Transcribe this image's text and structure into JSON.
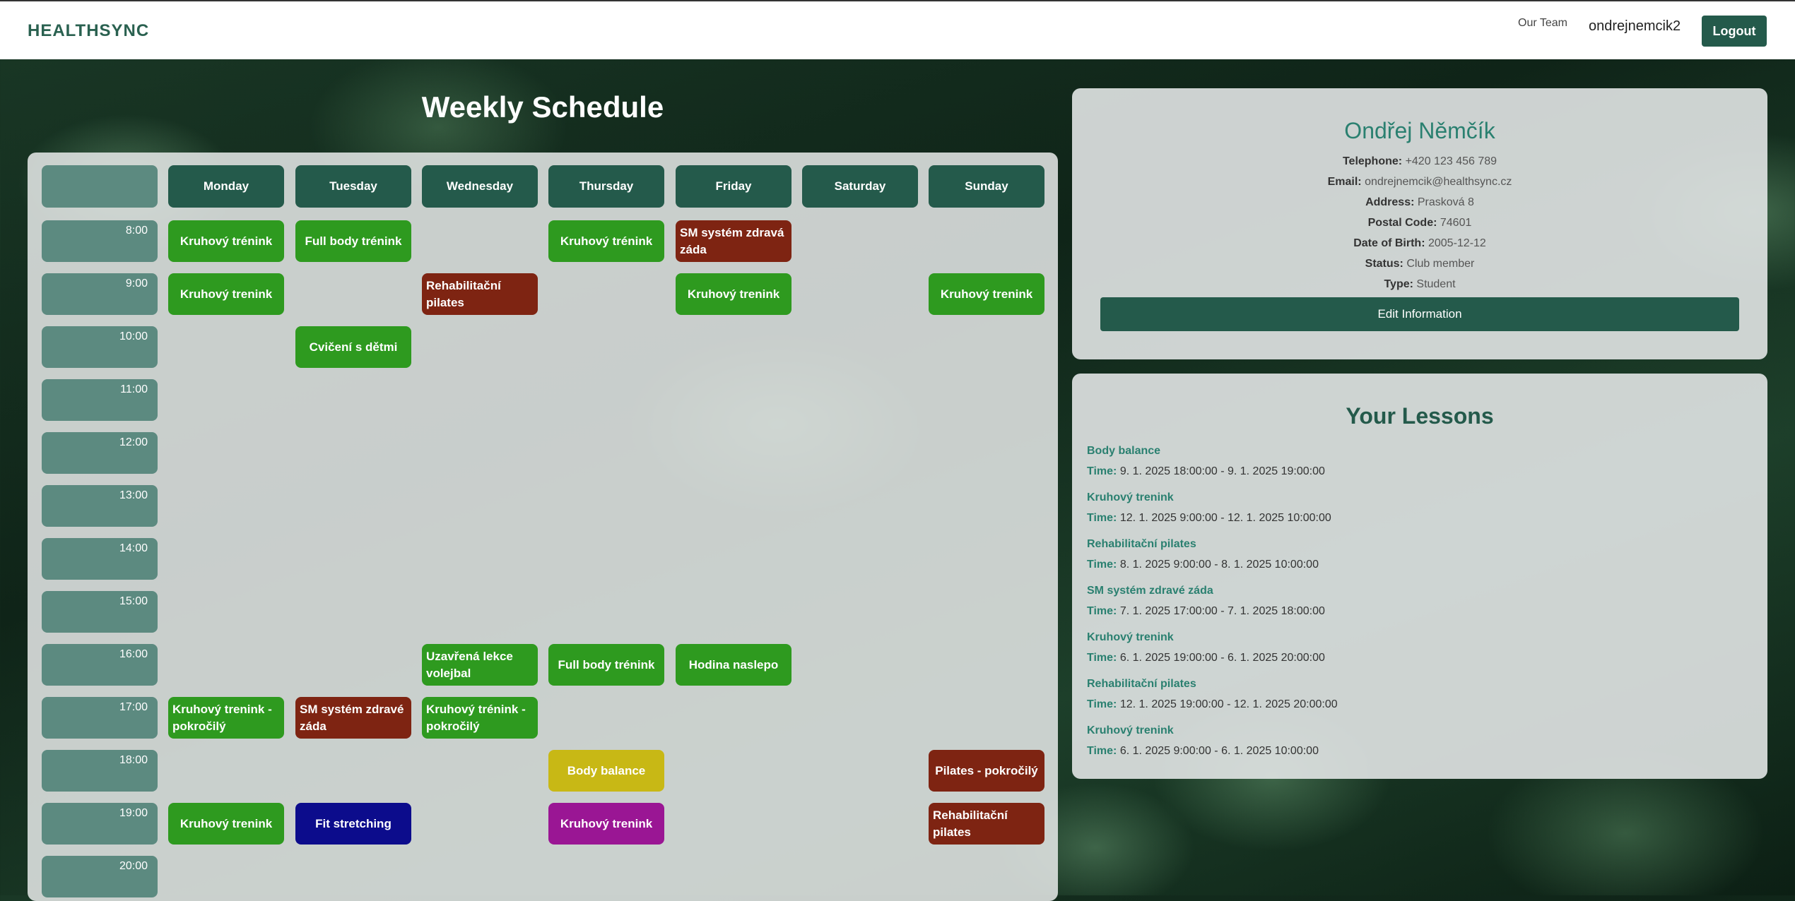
{
  "header": {
    "brand": "HEALTHSYNC",
    "nav_team": "Our Team",
    "username": "ondrejnemcik2",
    "logout_label": "Logout"
  },
  "schedule": {
    "title": "Weekly Schedule",
    "days": [
      "Monday",
      "Tuesday",
      "Wednesday",
      "Thursday",
      "Friday",
      "Saturday",
      "Sunday"
    ],
    "times": [
      "8:00",
      "9:00",
      "10:00",
      "11:00",
      "12:00",
      "13:00",
      "14:00",
      "15:00",
      "16:00",
      "17:00",
      "18:00",
      "19:00",
      "20:00"
    ],
    "lessons": [
      {
        "day": 0,
        "time": 0,
        "label": "Kruhový trénink",
        "color": "#2e9a1f",
        "align": "center"
      },
      {
        "day": 1,
        "time": 0,
        "label": "Full body trénink",
        "color": "#2e9a1f",
        "align": "center"
      },
      {
        "day": 3,
        "time": 0,
        "label": "Kruhový trénink",
        "color": "#2e9a1f",
        "align": "center"
      },
      {
        "day": 4,
        "time": 0,
        "label": "SM systém zdravá záda",
        "color": "#7e2412",
        "align": "left"
      },
      {
        "day": 0,
        "time": 1,
        "label": "Kruhový trenink",
        "color": "#2e9a1f",
        "align": "center"
      },
      {
        "day": 2,
        "time": 1,
        "label": "Rehabilitační pilates",
        "color": "#7e2412",
        "align": "left"
      },
      {
        "day": 4,
        "time": 1,
        "label": "Kruhový trenink",
        "color": "#2e9a1f",
        "align": "center"
      },
      {
        "day": 6,
        "time": 1,
        "label": "Kruhový trenink",
        "color": "#2e9a1f",
        "align": "center"
      },
      {
        "day": 1,
        "time": 2,
        "label": "Cvičení s dětmi",
        "color": "#2e9a1f",
        "align": "center"
      },
      {
        "day": 2,
        "time": 8,
        "label": "Uzavřená lekce volejbal",
        "color": "#2e9a1f",
        "align": "left"
      },
      {
        "day": 3,
        "time": 8,
        "label": "Full body trénink",
        "color": "#2e9a1f",
        "align": "center"
      },
      {
        "day": 4,
        "time": 8,
        "label": "Hodina naslepo",
        "color": "#2e9a1f",
        "align": "center"
      },
      {
        "day": 0,
        "time": 9,
        "label": "Kruhový trenink - pokročilý",
        "color": "#2e9a1f",
        "align": "left"
      },
      {
        "day": 1,
        "time": 9,
        "label": "SM systém zdravé záda",
        "color": "#7e2412",
        "align": "left"
      },
      {
        "day": 2,
        "time": 9,
        "label": "Kruhový trénink - pokročilý",
        "color": "#2e9a1f",
        "align": "left"
      },
      {
        "day": 3,
        "time": 10,
        "label": "Body balance",
        "color": "#c8b815",
        "align": "center"
      },
      {
        "day": 6,
        "time": 10,
        "label": "Pilates - pokročilý",
        "color": "#7e2412",
        "align": "center"
      },
      {
        "day": 0,
        "time": 11,
        "label": "Kruhový trenink",
        "color": "#2e9a1f",
        "align": "center"
      },
      {
        "day": 1,
        "time": 11,
        "label": "Fit stretching",
        "color": "#0c0c8c",
        "align": "center"
      },
      {
        "day": 3,
        "time": 11,
        "label": "Kruhový trenink",
        "color": "#9a1694",
        "align": "center"
      },
      {
        "day": 6,
        "time": 11,
        "label": "Rehabilitační pilates",
        "color": "#7e2412",
        "align": "left"
      }
    ]
  },
  "profile": {
    "name": "Ondřej Němčík",
    "fields": [
      {
        "label": "Telephone:",
        "value": "+420 123 456 789"
      },
      {
        "label": "Email:",
        "value": "ondrejnemcik@healthsync.cz"
      },
      {
        "label": "Address:",
        "value": "Prasková 8"
      },
      {
        "label": "Postal Code:",
        "value": "74601"
      },
      {
        "label": "Date of Birth:",
        "value": "2005-12-12"
      },
      {
        "label": "Status:",
        "value": "Club member"
      },
      {
        "label": "Type:",
        "value": "Student"
      }
    ],
    "edit_label": "Edit Information"
  },
  "your_lessons": {
    "title": "Your Lessons",
    "time_label": "Time:",
    "items": [
      {
        "name": "Body balance",
        "time": "9. 1. 2025 18:00:00 - 9. 1. 2025 19:00:00"
      },
      {
        "name": "Kruhový trenink",
        "time": "12. 1. 2025 9:00:00 - 12. 1. 2025 10:00:00"
      },
      {
        "name": "Rehabilitační pilates",
        "time": "8. 1. 2025 9:00:00 - 8. 1. 2025 10:00:00"
      },
      {
        "name": "SM systém zdravé záda",
        "time": "7. 1. 2025 17:00:00 - 7. 1. 2025 18:00:00"
      },
      {
        "name": "Kruhový trenink",
        "time": "6. 1. 2025 19:00:00 - 6. 1. 2025 20:00:00"
      },
      {
        "name": "Rehabilitační pilates",
        "time": "12. 1. 2025 19:00:00 - 12. 1. 2025 20:00:00"
      },
      {
        "name": "Kruhový trenink",
        "time": "6. 1. 2025 9:00:00 - 6. 1. 2025 10:00:00"
      }
    ]
  }
}
